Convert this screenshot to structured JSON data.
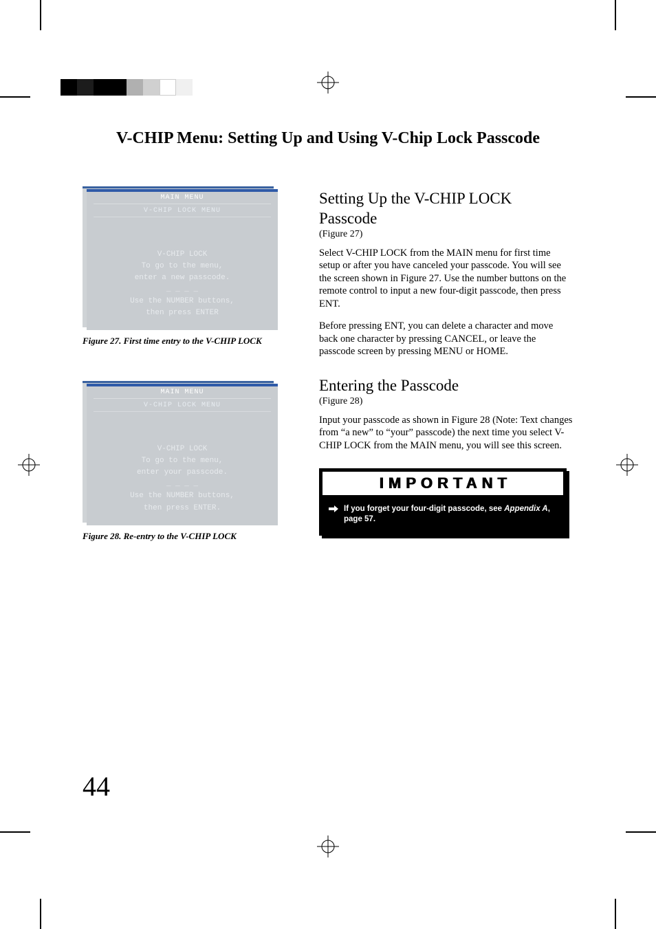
{
  "heading": "V-CHIP Menu:  Setting Up and Using V-Chip Lock Passcode",
  "screen1": {
    "header": "MAIN MENU",
    "sub": "V-CHIP LOCK MENU",
    "l1": "V-CHIP LOCK",
    "l2": "To go to the menu,",
    "l3": "enter a new passcode.",
    "l4": "_ _ _ _",
    "l5": "Use the NUMBER buttons,",
    "l6": "then press ENTER"
  },
  "fig1_caption": "Figure 27.  First time entry to the V-CHIP LOCK",
  "screen2": {
    "header": "MAIN MENU",
    "sub": "V-CHIP LOCK MENU",
    "l1": "V-CHIP LOCK",
    "l2": "To go to the menu,",
    "l3": "enter your passcode.",
    "l4": "_ _ _ _",
    "l5": "Use the NUMBER buttons,",
    "l6": "then press ENTER."
  },
  "fig2_caption": "Figure 28. Re-entry to the V-CHIP LOCK",
  "section1": {
    "title": "Setting Up the V-CHIP LOCK Passcode",
    "figref": "(Figure 27)",
    "p1": "Select V-CHIP LOCK from the MAIN menu for first time setup or after you have canceled your passcode. You will see the screen shown in Figure 27.  Use the number buttons on the remote control to input a new four-digit passcode, then press ENT.",
    "p2": "Before pressing ENT, you can delete a character and move back one character by pressing CANCEL, or leave the passcode screen by pressing  MENU or HOME."
  },
  "section2": {
    "title": "Entering the Passcode",
    "figref": "(Figure 28)",
    "p1": "Input your passcode as shown in Figure 28 (Note: Text changes from “a new” to “your” passcode) the next time you select V-CHIP LOCK from the MAIN menu, you will see this screen."
  },
  "important": {
    "head": "IMPORTANT",
    "body_pre": "If you forget your four-digit passcode, see ",
    "body_ital": "Appendix A",
    "body_post": ", page 57."
  },
  "page_number": "44"
}
